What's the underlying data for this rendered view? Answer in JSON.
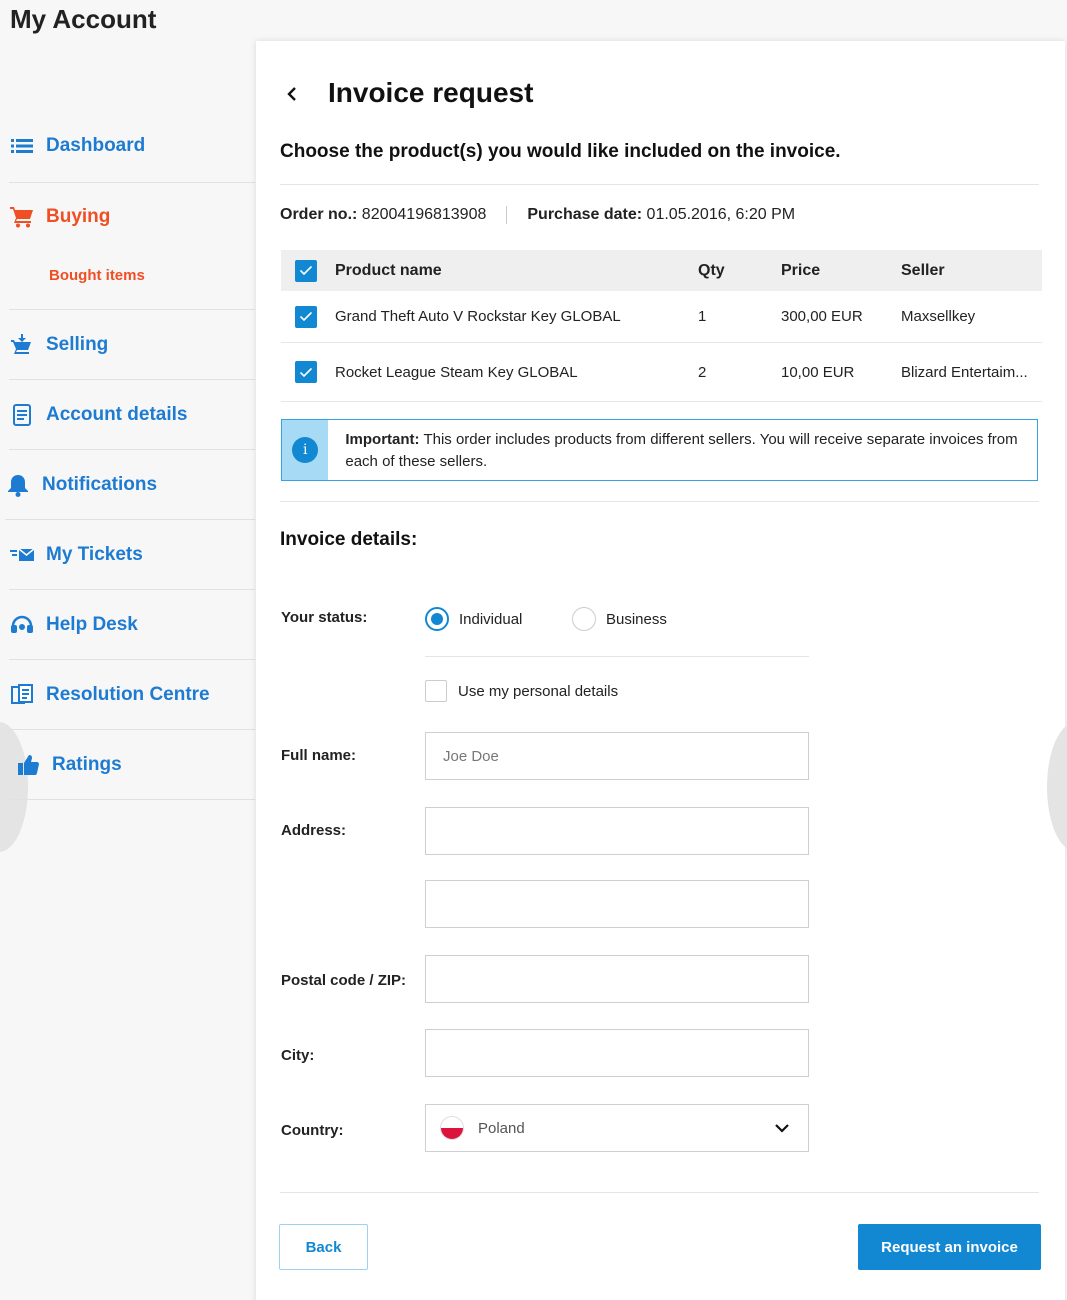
{
  "page_title": "My Account",
  "sidebar": {
    "items": [
      {
        "label": "Dashboard",
        "icon": "list-icon"
      },
      {
        "label": "Buying",
        "icon": "cart-icon",
        "sub": "Bought items"
      },
      {
        "label": "Selling",
        "icon": "sell-cart-icon"
      },
      {
        "label": "Account details",
        "icon": "document-icon"
      },
      {
        "label": "Notifications",
        "icon": "bell-icon"
      },
      {
        "label": "My Tickets",
        "icon": "ticket-icon"
      },
      {
        "label": "Help Desk",
        "icon": "headset-icon"
      },
      {
        "label": "Resolution Centre",
        "icon": "papers-icon"
      },
      {
        "label": "Ratings",
        "icon": "thumbs-up-icon"
      }
    ]
  },
  "panel": {
    "title": "Invoice request",
    "intro": "Choose the product(s) you would like included on the invoice.",
    "order_label": "Order no.:",
    "order_no": "82004196813908",
    "purchase_label": "Purchase date:",
    "purchase_date": "01.05.2016, 6:20 PM"
  },
  "table": {
    "headers": {
      "name": "Product name",
      "qty": "Qty",
      "price": "Price",
      "seller": "Seller"
    },
    "rows": [
      {
        "name": "Grand Theft Auto V Rockstar Key GLOBAL",
        "qty": "1",
        "price": "300,00 EUR",
        "seller": "Maxsellkey"
      },
      {
        "name": "Rocket League Steam Key GLOBAL",
        "qty": "2",
        "price": "10,00 EUR",
        "seller": "Blizard Entertaim..."
      }
    ]
  },
  "info": {
    "icon_letter": "i",
    "strong": "Important:",
    "text": " This order includes products from different sellers. You will receive separate invoices from each of these sellers."
  },
  "form": {
    "section_title": "Invoice details:",
    "status_label": "Your status:",
    "status_options": [
      "Individual",
      "Business"
    ],
    "status_selected": "Individual",
    "personal_details": "Use my personal details",
    "fullname_label": "Full name:",
    "fullname_placeholder": "Joe Doe",
    "address_label": "Address:",
    "postal_label": "Postal code / ZIP:",
    "city_label": "City:",
    "country_label": "Country:",
    "country_value": "Poland"
  },
  "buttons": {
    "back": "Back",
    "request": "Request an invoice"
  },
  "colors": {
    "accent": "#1288d2",
    "nav": "#1e7bd2",
    "active": "#f04e23"
  }
}
